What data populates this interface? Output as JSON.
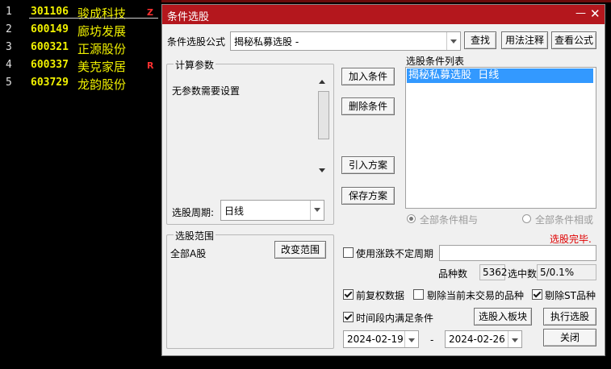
{
  "stock_list": [
    {
      "index": "1",
      "code": "301106",
      "name": "骏成科技",
      "mark": "Z"
    },
    {
      "index": "2",
      "code": "600149",
      "name": "廊坊发展",
      "mark": ""
    },
    {
      "index": "3",
      "code": "600321",
      "name": "正源股份",
      "mark": ""
    },
    {
      "index": "4",
      "code": "600337",
      "name": "美克家居",
      "mark": "R"
    },
    {
      "index": "5",
      "code": "603729",
      "name": "龙韵股份",
      "mark": ""
    }
  ],
  "dialog": {
    "title": "条件选股",
    "formula_label": "条件选股公式",
    "formula_value": "揭秘私募选股 -",
    "find_button": "查找",
    "usage_button": "用法注释",
    "view_formula_button": "查看公式",
    "params_group": "计算参数",
    "params_text": "无参数需要设置",
    "period_label": "选股周期:",
    "period_value": "日线",
    "add_condition": "加入条件",
    "delete_condition": "删除条件",
    "import_plan": "引入方案",
    "save_plan": "保存方案",
    "condition_list_label": "选股条件列表",
    "conditions": [
      "揭秘私募选股  日线"
    ],
    "radio_and": "全部条件相与",
    "radio_or": "全部条件相或",
    "status": "选股完毕.",
    "range_group": "选股范围",
    "range_value": "全部A股",
    "change_range": "改变范围",
    "uncertain_period_label": "使用涨跌不定周期",
    "uncertain_period_value": "",
    "variety_count_label": "品种数",
    "variety_count_value": "5362",
    "selected_count_label": "选中数",
    "selected_count_value": "5/0.1%",
    "pre_adjusted": "前复权数据",
    "exclude_non_trading": "剔除当前未交易的品种",
    "exclude_st": "剔除ST品种",
    "period_satisfy": "时间段内满足条件",
    "to_block_button": "选股入板块",
    "run_button": "执行选股",
    "date_from": "2024-02-19",
    "date_sep": "-",
    "date_to": "2024-02-26",
    "close_button": "关闭",
    "checks": {
      "pre_adjusted": true,
      "exclude_non_trading": false,
      "exclude_st": true,
      "period_satisfy": true,
      "uncertain_period": false
    }
  },
  "colors": {
    "title_bar": "#b4171d",
    "code_text": "#f0f000",
    "status_text": "#e00000",
    "selection": "#3399ff"
  }
}
